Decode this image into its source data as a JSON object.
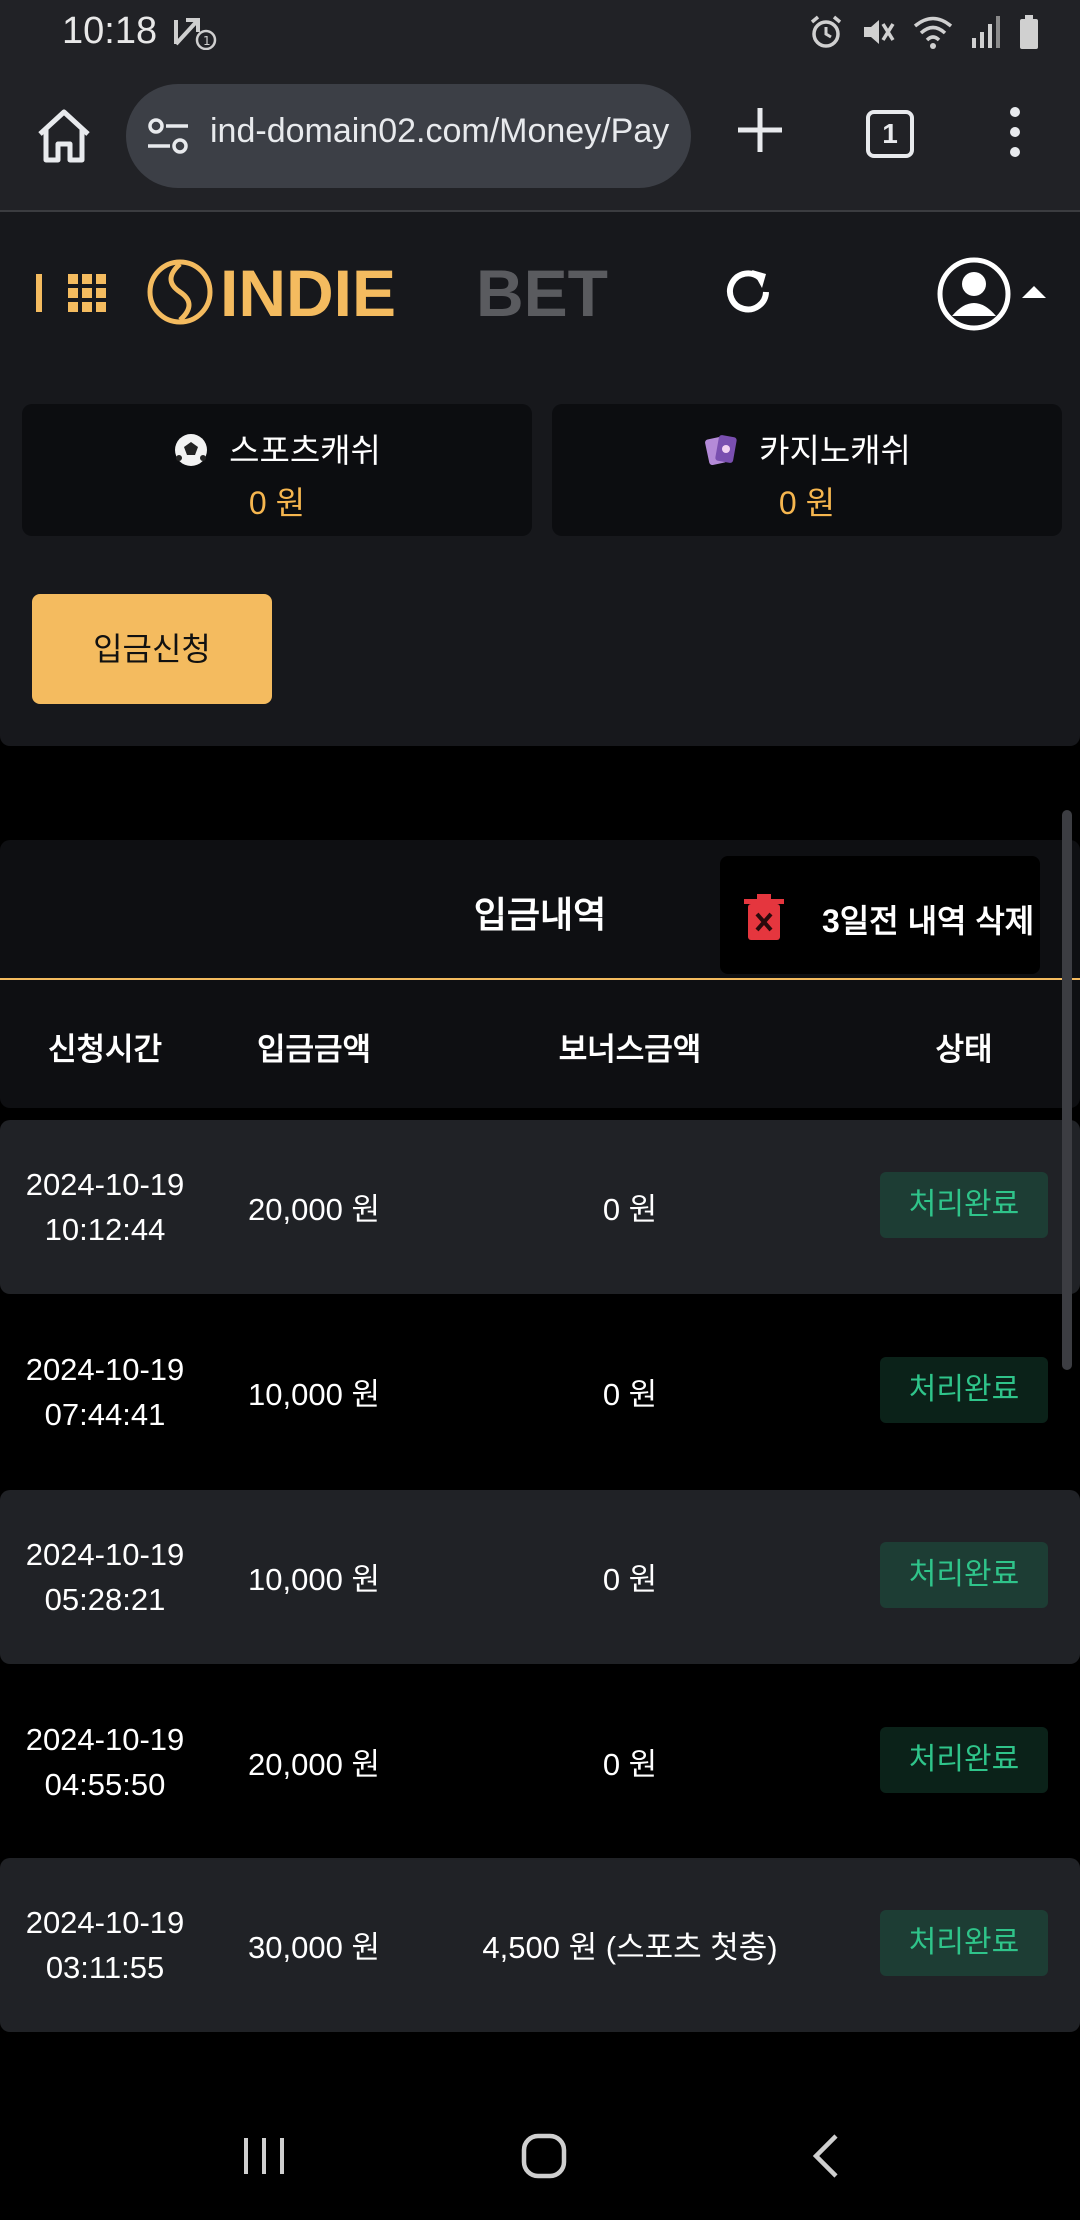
{
  "status_bar": {
    "time": "10:18"
  },
  "browser": {
    "url": "ind-domain02.com/Money/Pay",
    "tab_count": "1"
  },
  "header": {
    "logo_part1": "INDIE",
    "logo_part2": "BET"
  },
  "cash": {
    "sports": {
      "label": "스포츠캐쉬",
      "amount": "0 원"
    },
    "casino": {
      "label": "카지노캐쉬",
      "amount": "0 원"
    }
  },
  "deposit_button": "입금신청",
  "history": {
    "title": "입금내역",
    "delete_label": "3일전 내역 삭제",
    "columns": [
      "신청시간",
      "입금금액",
      "보너스금액",
      "상태"
    ],
    "rows": [
      {
        "date": "2024-10-19",
        "time": "10:12:44",
        "amount": "20,000 원",
        "bonus": "0 원",
        "status": "처리완료"
      },
      {
        "date": "2024-10-19",
        "time": "07:44:41",
        "amount": "10,000 원",
        "bonus": "0 원",
        "status": "처리완료"
      },
      {
        "date": "2024-10-19",
        "time": "05:28:21",
        "amount": "10,000 원",
        "bonus": "0 원",
        "status": "처리완료"
      },
      {
        "date": "2024-10-19",
        "time": "04:55:50",
        "amount": "20,000 원",
        "bonus": "0 원",
        "status": "처리완료"
      },
      {
        "date": "2024-10-19",
        "time": "03:11:55",
        "amount": "30,000 원",
        "bonus": "4,500 원 (스포츠 첫충)",
        "status": "처리완료"
      }
    ]
  },
  "colors": {
    "accent": "#f4bb5f",
    "status_text": "#2fc48a",
    "panel": "#17181c",
    "row_shade": "#202226"
  }
}
